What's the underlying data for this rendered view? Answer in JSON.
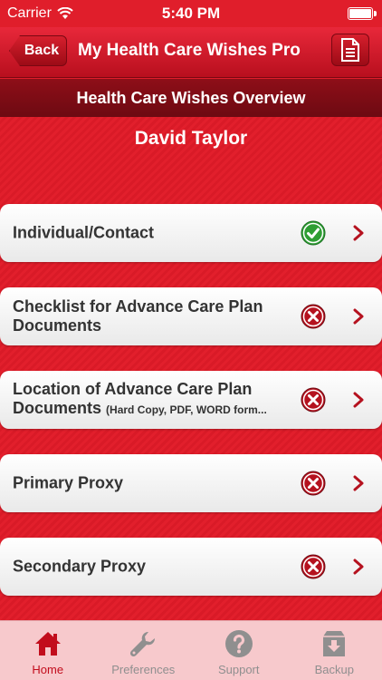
{
  "status_bar": {
    "carrier": "Carrier",
    "time": "5:40 PM"
  },
  "nav": {
    "back_label": "Back",
    "title": "My Health Care Wishes Pro"
  },
  "section": {
    "title": "Health Care Wishes Overview"
  },
  "person": {
    "name": "David Taylor"
  },
  "items": [
    {
      "label": "Individual/Contact",
      "sub": "",
      "status": "complete"
    },
    {
      "label": "Checklist for Advance Care Plan Documents",
      "sub": "",
      "status": "incomplete"
    },
    {
      "label": "Location of Advance Care Plan Documents",
      "sub": "(Hard Copy, PDF, WORD form...",
      "status": "incomplete"
    },
    {
      "label": "Primary Proxy",
      "sub": "",
      "status": "incomplete"
    },
    {
      "label": "Secondary Proxy",
      "sub": "",
      "status": "incomplete"
    }
  ],
  "tabs": [
    {
      "label": "Home",
      "icon": "home-icon",
      "active": true
    },
    {
      "label": "Preferences",
      "icon": "wrench-icon",
      "active": false
    },
    {
      "label": "Support",
      "icon": "question-icon",
      "active": false
    },
    {
      "label": "Backup",
      "icon": "backup-box-icon",
      "active": false
    }
  ],
  "colors": {
    "accent": "#e01e2b",
    "dark_red": "#7a0a13",
    "complete": "#2e9e34",
    "incomplete": "#b5121f"
  }
}
